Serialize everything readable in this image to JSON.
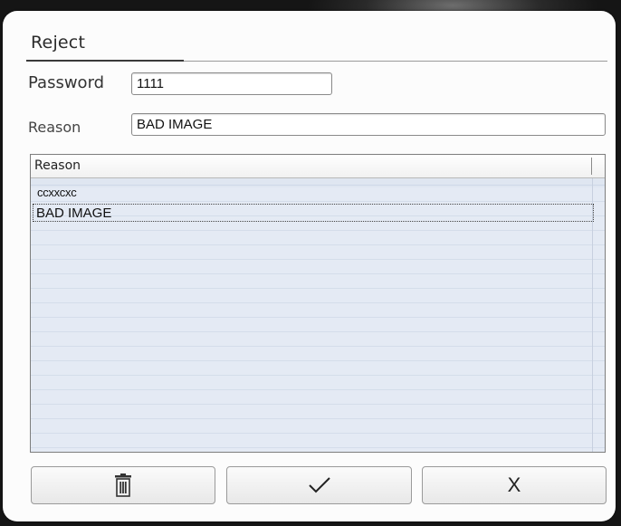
{
  "dialog": {
    "title": "Reject",
    "password": {
      "label": "Password",
      "value": "1111"
    },
    "reason": {
      "label": "Reason",
      "value": "BAD IMAGE"
    },
    "reason_list": {
      "header": "Reason",
      "items": [
        "ccxxcxc",
        "BAD IMAGE"
      ],
      "selected_index": 1
    },
    "buttons": {
      "delete_icon": "trash-icon",
      "confirm_icon": "checkmark-icon",
      "cancel_label": "X"
    }
  }
}
